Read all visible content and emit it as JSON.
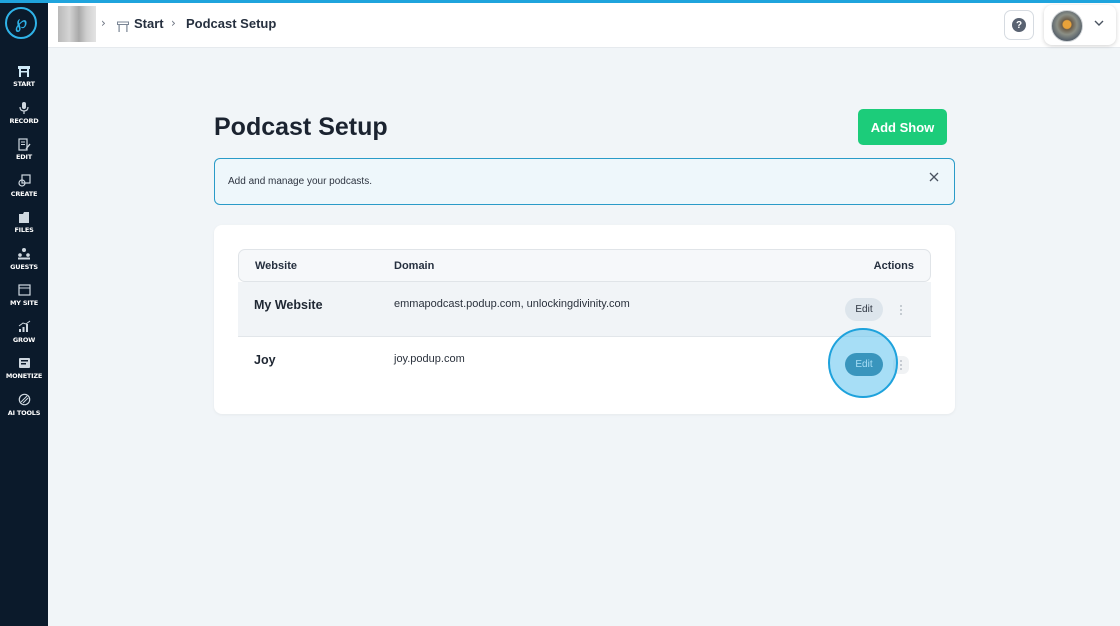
{
  "colors": {
    "accent": "#1fa4dd",
    "sidebar_bg": "#0b1a2b",
    "primary_green": "#1ccc7a",
    "edit_active": "#0d5e80"
  },
  "sidebar": {
    "logo_icon": "podup-logo-icon",
    "items": [
      {
        "label": "START",
        "icon": "start-icon",
        "active": true
      },
      {
        "label": "RECORD",
        "icon": "mic-icon"
      },
      {
        "label": "EDIT",
        "icon": "edit-icon"
      },
      {
        "label": "CREATE",
        "icon": "create-icon"
      },
      {
        "label": "FILES",
        "icon": "files-icon"
      },
      {
        "label": "GUESTS",
        "icon": "guests-icon"
      },
      {
        "label": "MY SITE",
        "icon": "site-icon"
      },
      {
        "label": "GROW",
        "icon": "grow-icon"
      },
      {
        "label": "MONETIZE",
        "icon": "monetize-icon"
      },
      {
        "label": "AI TOOLS",
        "icon": "ai-icon"
      }
    ]
  },
  "header": {
    "breadcrumb": {
      "start": "Start",
      "current": "Podcast Setup"
    },
    "help_icon": "?"
  },
  "main": {
    "title": "Podcast Setup",
    "add_show_label": "Add Show",
    "info_text": "Add and manage your podcasts.",
    "table": {
      "headers": {
        "website": "Website",
        "domain": "Domain",
        "actions": "Actions"
      },
      "rows": [
        {
          "website": "My Website",
          "domain": "emmapodcast.podup.com, unlockingdivinity.com",
          "edit_label": "Edit"
        },
        {
          "website": "Joy",
          "domain": "joy.podup.com",
          "edit_label": "Edit"
        }
      ]
    }
  }
}
